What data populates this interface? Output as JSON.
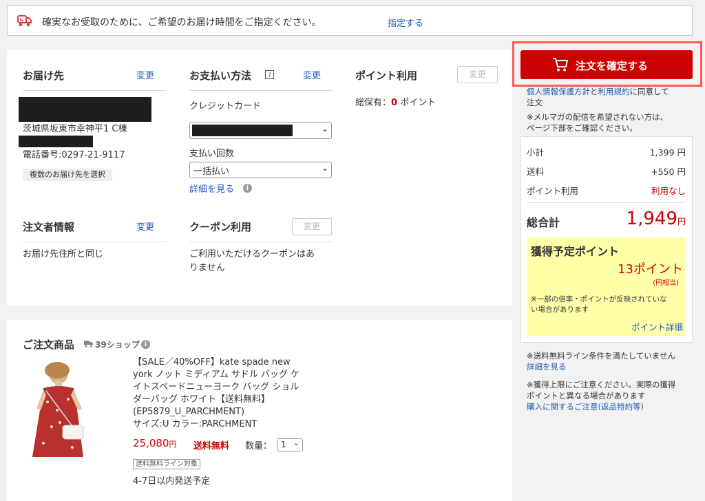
{
  "banner": {
    "message": "確実なお受取のために、ご希望のお届け時間をご指定ください。",
    "link": "指定する",
    "icon": "truck-icon"
  },
  "delivery": {
    "title": "お届け先",
    "change": "変更",
    "address": "茨城県坂東市幸神平1 C棟",
    "phone": "電話番号:0297-21-9117",
    "multi_button": "複数のお届け先を選択"
  },
  "payment": {
    "title": "お支払い方法",
    "change": "変更",
    "method": "クレジットカード",
    "installment_label": "支払い回数",
    "installment_value": "一括払い",
    "details_link": "詳細を見る"
  },
  "points": {
    "title": "ポイント利用",
    "change": "変更",
    "balance_prefix": "総保有：",
    "balance_value": "0",
    "balance_suffix": "ポイント"
  },
  "orderer": {
    "title": "注文者情報",
    "change": "変更",
    "value": "お届け先住所と同じ"
  },
  "coupon": {
    "title": "クーポン利用",
    "change": "変更",
    "line1": "ご利用いただけるクーポンはあ",
    "line2": "りません"
  },
  "products": {
    "title": "ご注文商品",
    "shop_label": "39ショップ",
    "item": {
      "name_lines": [
        "【SALE／40%OFF】kate spade new",
        "york ノット ミディアム サドル バッグ ケ",
        "イトスペードニューヨーク バッグ ショル",
        "ダーバッグ ホワイト【送料無料】",
        "(EP5879_U_PARCHMENT)",
        "サイズ:U カラー:PARCHMENT"
      ],
      "price": "25,080",
      "price_unit": "円",
      "free_shipping": "送料無料",
      "qty_label": "数量：",
      "qty_value": "1",
      "tag": "送料無料ライン対象",
      "ship_note": "4-7日以内発送予定"
    }
  },
  "sidebar": {
    "confirm_button": "注文を確定する",
    "privacy_link": "個人情報保護方針",
    "and": "と",
    "terms_link": "利用規約",
    "agree_suffix": "に同意して",
    "agree_line2": "注文",
    "mailmag_line1": "※メルマガの配信を希望されない方は、",
    "mailmag_line2": "ページ下部をご確認ください。",
    "summary": {
      "subtotal_label": "小計",
      "subtotal_value": "1,399 円",
      "shipping_label": "送料",
      "shipping_value": "+550 円",
      "points_label": "ポイント利用",
      "points_value": "利用なし",
      "total_label": "総合計",
      "total_value": "1,949",
      "total_unit": "円"
    },
    "earn": {
      "title": "獲得予定ポイント",
      "value": "13ポイント",
      "sub": "(円相当)",
      "note_line1": "※一部の倍率・ポイントが反映されていな",
      "note_line2": "い場合があります",
      "detail_link": "ポイント詳細"
    },
    "free_ship_note": "※送料無料ライン条件を満たしていません",
    "free_ship_link": "詳細を見る",
    "limit_line1": "※獲得上限にご注意ください。実際の獲得",
    "limit_line2": "ポイントと異なる場合があります",
    "returns_link": "購入に関するご注意(返品特約等)"
  },
  "colors": {
    "accent_red": "#cc0000",
    "link_blue": "#1e5bb8",
    "highlight_yellow": "#ffffa8",
    "outline_red": "#ff5a52"
  }
}
